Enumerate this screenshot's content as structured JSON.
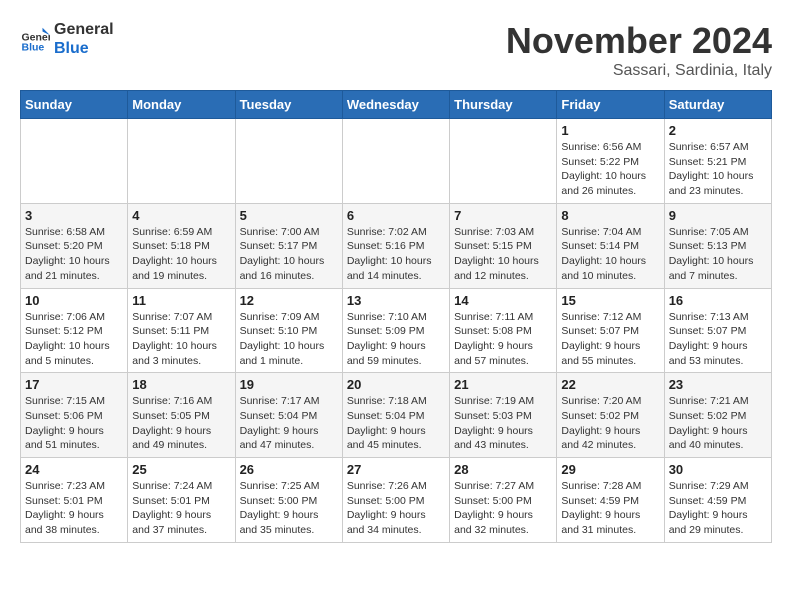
{
  "logo": {
    "text_general": "General",
    "text_blue": "Blue"
  },
  "header": {
    "month_year": "November 2024",
    "location": "Sassari, Sardinia, Italy"
  },
  "weekdays": [
    "Sunday",
    "Monday",
    "Tuesday",
    "Wednesday",
    "Thursday",
    "Friday",
    "Saturday"
  ],
  "weeks": [
    [
      {
        "day": "",
        "info": ""
      },
      {
        "day": "",
        "info": ""
      },
      {
        "day": "",
        "info": ""
      },
      {
        "day": "",
        "info": ""
      },
      {
        "day": "",
        "info": ""
      },
      {
        "day": "1",
        "info": "Sunrise: 6:56 AM\nSunset: 5:22 PM\nDaylight: 10 hours and 26 minutes."
      },
      {
        "day": "2",
        "info": "Sunrise: 6:57 AM\nSunset: 5:21 PM\nDaylight: 10 hours and 23 minutes."
      }
    ],
    [
      {
        "day": "3",
        "info": "Sunrise: 6:58 AM\nSunset: 5:20 PM\nDaylight: 10 hours and 21 minutes."
      },
      {
        "day": "4",
        "info": "Sunrise: 6:59 AM\nSunset: 5:18 PM\nDaylight: 10 hours and 19 minutes."
      },
      {
        "day": "5",
        "info": "Sunrise: 7:00 AM\nSunset: 5:17 PM\nDaylight: 10 hours and 16 minutes."
      },
      {
        "day": "6",
        "info": "Sunrise: 7:02 AM\nSunset: 5:16 PM\nDaylight: 10 hours and 14 minutes."
      },
      {
        "day": "7",
        "info": "Sunrise: 7:03 AM\nSunset: 5:15 PM\nDaylight: 10 hours and 12 minutes."
      },
      {
        "day": "8",
        "info": "Sunrise: 7:04 AM\nSunset: 5:14 PM\nDaylight: 10 hours and 10 minutes."
      },
      {
        "day": "9",
        "info": "Sunrise: 7:05 AM\nSunset: 5:13 PM\nDaylight: 10 hours and 7 minutes."
      }
    ],
    [
      {
        "day": "10",
        "info": "Sunrise: 7:06 AM\nSunset: 5:12 PM\nDaylight: 10 hours and 5 minutes."
      },
      {
        "day": "11",
        "info": "Sunrise: 7:07 AM\nSunset: 5:11 PM\nDaylight: 10 hours and 3 minutes."
      },
      {
        "day": "12",
        "info": "Sunrise: 7:09 AM\nSunset: 5:10 PM\nDaylight: 10 hours and 1 minute."
      },
      {
        "day": "13",
        "info": "Sunrise: 7:10 AM\nSunset: 5:09 PM\nDaylight: 9 hours and 59 minutes."
      },
      {
        "day": "14",
        "info": "Sunrise: 7:11 AM\nSunset: 5:08 PM\nDaylight: 9 hours and 57 minutes."
      },
      {
        "day": "15",
        "info": "Sunrise: 7:12 AM\nSunset: 5:07 PM\nDaylight: 9 hours and 55 minutes."
      },
      {
        "day": "16",
        "info": "Sunrise: 7:13 AM\nSunset: 5:07 PM\nDaylight: 9 hours and 53 minutes."
      }
    ],
    [
      {
        "day": "17",
        "info": "Sunrise: 7:15 AM\nSunset: 5:06 PM\nDaylight: 9 hours and 51 minutes."
      },
      {
        "day": "18",
        "info": "Sunrise: 7:16 AM\nSunset: 5:05 PM\nDaylight: 9 hours and 49 minutes."
      },
      {
        "day": "19",
        "info": "Sunrise: 7:17 AM\nSunset: 5:04 PM\nDaylight: 9 hours and 47 minutes."
      },
      {
        "day": "20",
        "info": "Sunrise: 7:18 AM\nSunset: 5:04 PM\nDaylight: 9 hours and 45 minutes."
      },
      {
        "day": "21",
        "info": "Sunrise: 7:19 AM\nSunset: 5:03 PM\nDaylight: 9 hours and 43 minutes."
      },
      {
        "day": "22",
        "info": "Sunrise: 7:20 AM\nSunset: 5:02 PM\nDaylight: 9 hours and 42 minutes."
      },
      {
        "day": "23",
        "info": "Sunrise: 7:21 AM\nSunset: 5:02 PM\nDaylight: 9 hours and 40 minutes."
      }
    ],
    [
      {
        "day": "24",
        "info": "Sunrise: 7:23 AM\nSunset: 5:01 PM\nDaylight: 9 hours and 38 minutes."
      },
      {
        "day": "25",
        "info": "Sunrise: 7:24 AM\nSunset: 5:01 PM\nDaylight: 9 hours and 37 minutes."
      },
      {
        "day": "26",
        "info": "Sunrise: 7:25 AM\nSunset: 5:00 PM\nDaylight: 9 hours and 35 minutes."
      },
      {
        "day": "27",
        "info": "Sunrise: 7:26 AM\nSunset: 5:00 PM\nDaylight: 9 hours and 34 minutes."
      },
      {
        "day": "28",
        "info": "Sunrise: 7:27 AM\nSunset: 5:00 PM\nDaylight: 9 hours and 32 minutes."
      },
      {
        "day": "29",
        "info": "Sunrise: 7:28 AM\nSunset: 4:59 PM\nDaylight: 9 hours and 31 minutes."
      },
      {
        "day": "30",
        "info": "Sunrise: 7:29 AM\nSunset: 4:59 PM\nDaylight: 9 hours and 29 minutes."
      }
    ]
  ]
}
